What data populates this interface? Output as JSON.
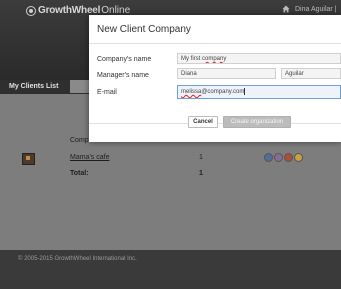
{
  "header": {
    "brand": "GrowthWheel",
    "brand_suffix": "Online",
    "user_name": "Dina Aguilar |"
  },
  "tabs": [
    {
      "label": "My Clients List"
    }
  ],
  "table": {
    "col_company": "Compa",
    "row": {
      "name": "Mama's cafe",
      "count": "1"
    },
    "total_label": "Total:",
    "total_count": "1"
  },
  "footer": {
    "copyright": "© 2005-2015 GrowthWheel International Inc."
  },
  "modal": {
    "title": "New Client Company",
    "company_label": "Company's name",
    "company_value": "My first company",
    "company_value_main": "My first ",
    "company_value_flagged": "company",
    "manager_label": "Manager's name",
    "first_name": "Diana",
    "last_name": "Aguilar",
    "email_label": "E-mail",
    "email_flagged": "melissa",
    "email_rest": "@company.com",
    "cancel": "Cancel",
    "create": "Create organization"
  },
  "colors": {
    "header_bg": "#2f2f2f",
    "overlay": "#7d7d7d",
    "focus_border": "#6f9fd8",
    "create_button": "#bcbcbc",
    "dots": [
      "#4d6f9c",
      "#8a6a9a",
      "#b34a3a",
      "#c9a040"
    ]
  }
}
